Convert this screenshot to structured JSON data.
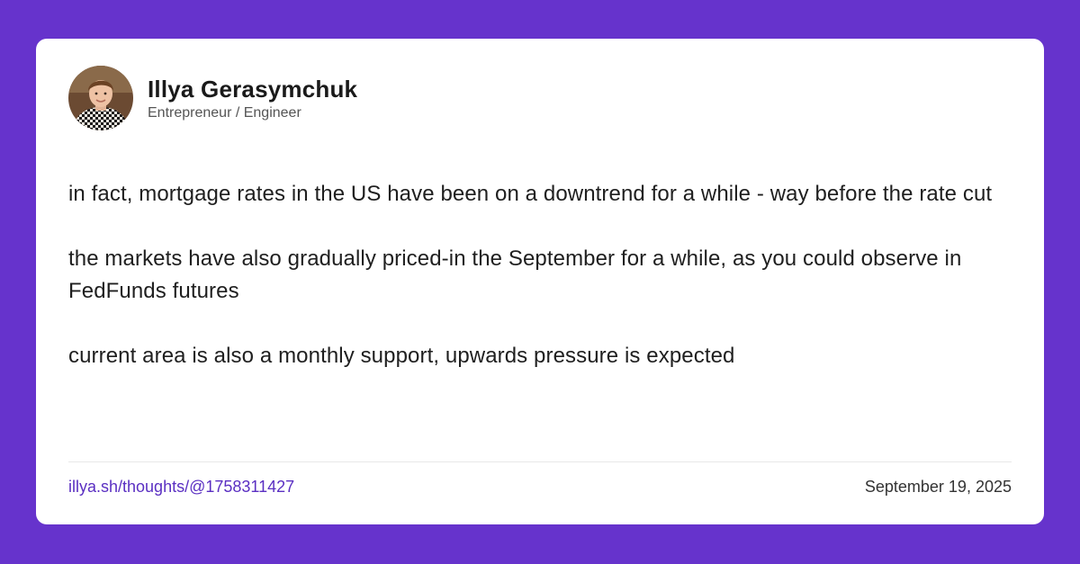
{
  "theme": {
    "background": "#6633cc",
    "card": "#ffffff",
    "link_color": "#5a2fc2"
  },
  "author": {
    "name": "Illya Gerasymchuk",
    "title": "Entrepreneur / Engineer",
    "avatar_icon": "profile-photo"
  },
  "post": {
    "paragraphs": [
      "in fact, mortgage rates in the US have been on a downtrend for a while - way before the rate cut",
      "the markets have also gradually priced-in the September for a while, as you could observe in FedFunds futures",
      "current area is also a monthly support, upwards pressure is expected"
    ]
  },
  "footer": {
    "link": "illya.sh/thoughts/@1758311427",
    "date": "September 19, 2025"
  }
}
